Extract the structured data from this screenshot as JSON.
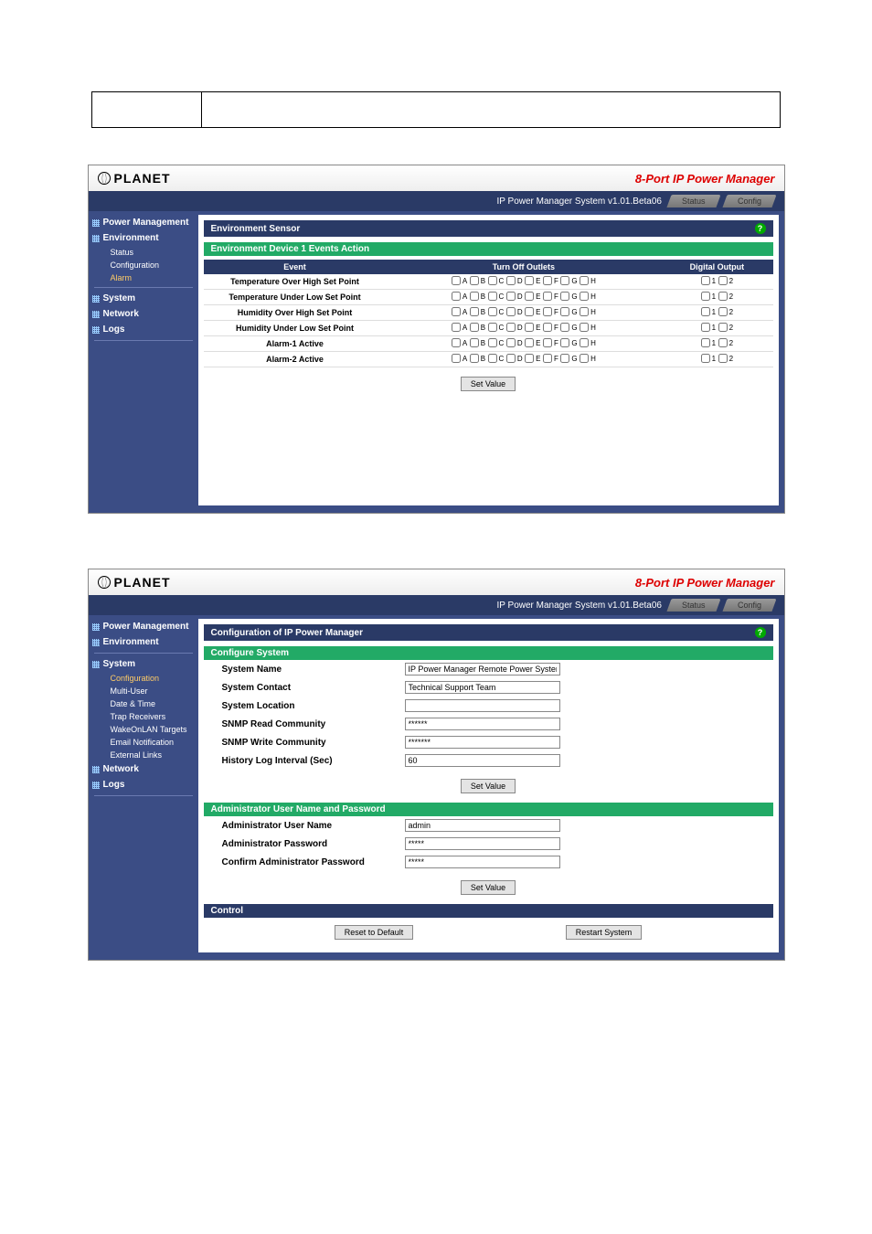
{
  "product": "8-Port IP Power Manager",
  "brand": "PLANET",
  "sysline": "IP Power Manager System v1.01.Beta06",
  "tabs": [
    "Status",
    "Config"
  ],
  "nav1": {
    "groups": [
      "Power Management",
      "Environment",
      "System",
      "Network",
      "Logs"
    ],
    "env_sub": [
      "Status",
      "Configuration",
      "Alarm"
    ]
  },
  "nav2": {
    "groups": [
      "Power Management",
      "Environment",
      "System",
      "Network",
      "Logs"
    ],
    "sys_sub": [
      "Configuration",
      "Multi-User",
      "Date & Time",
      "Trap Receivers",
      "WakeOnLAN Targets",
      "Email Notification",
      "External Links"
    ]
  },
  "screen1": {
    "title": "Environment Sensor",
    "section": "Environment Device 1 Events Action",
    "th_event": "Event",
    "th_turnoff": "Turn Off Outlets",
    "th_digital": "Digital Output",
    "events": [
      "Temperature Over High Set Point",
      "Temperature Under Low Set Point",
      "Humidity Over High Set Point",
      "Humidity Under Low Set Point",
      "Alarm-1 Active",
      "Alarm-2 Active"
    ],
    "outlets": [
      "A",
      "B",
      "C",
      "D",
      "E",
      "F",
      "G",
      "H"
    ],
    "digitals": [
      "1",
      "2"
    ],
    "set": "Set Value"
  },
  "screen2": {
    "title": "Configuration of IP Power Manager",
    "sect_conf": "Configure System",
    "sect_admin": "Administrator User Name and Password",
    "sect_ctrl": "Control",
    "fields_conf": [
      {
        "l": "System Name",
        "v": "IP Power Manager Remote Power System"
      },
      {
        "l": "System Contact",
        "v": "Technical Support Team"
      },
      {
        "l": "System Location",
        "v": ""
      },
      {
        "l": "SNMP Read Community",
        "v": "******"
      },
      {
        "l": "SNMP Write Community",
        "v": "*******"
      },
      {
        "l": "History Log Interval (Sec)",
        "v": "60"
      }
    ],
    "fields_admin": [
      {
        "l": "Administrator User Name",
        "v": "admin"
      },
      {
        "l": "Administrator Password",
        "v": "*****"
      },
      {
        "l": "Confirm Administrator Password",
        "v": "*****"
      }
    ],
    "set": "Set Value",
    "reset": "Reset to Default",
    "restart": "Restart System"
  }
}
